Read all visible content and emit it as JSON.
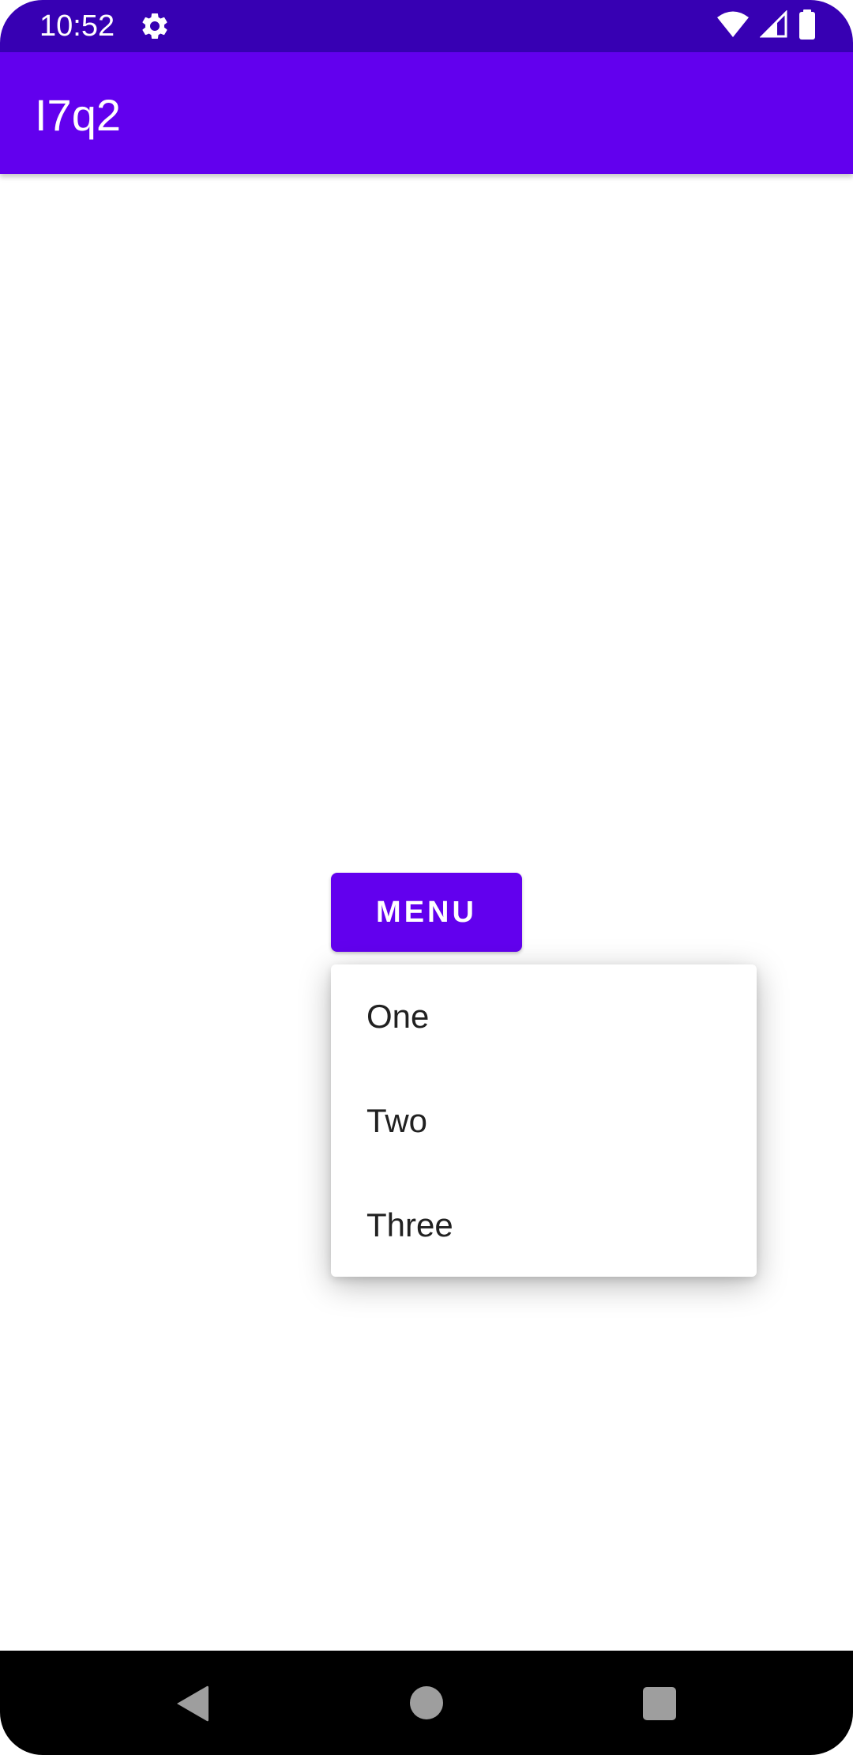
{
  "status_bar": {
    "time": "10:52",
    "icons": [
      "gear-icon",
      "wifi-icon",
      "signal-icon",
      "battery-icon"
    ]
  },
  "app_bar": {
    "title": "I7q2"
  },
  "main": {
    "menu_button_label": "MENU"
  },
  "popup_menu": {
    "items": [
      {
        "label": "One"
      },
      {
        "label": "Two"
      },
      {
        "label": "Three"
      }
    ]
  },
  "nav_bar": {
    "icons": [
      "back-icon",
      "home-icon",
      "recents-icon"
    ]
  },
  "colors": {
    "status_bar": "#3700b3",
    "primary": "#6200ee",
    "menu_text": "#212121",
    "nav_bar": "#000000"
  }
}
